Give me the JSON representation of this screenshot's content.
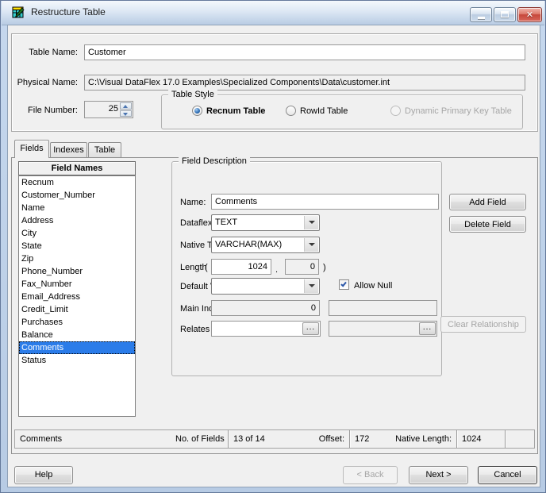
{
  "window": {
    "title": "Restructure Table",
    "icon": "table-edit",
    "controls": {
      "minimize": "minimize",
      "maximize": "maximize",
      "close_glyph": "✕"
    }
  },
  "colors": {
    "titlebar": "#D5E2F2",
    "frame": "#BDD1E9",
    "dialog_bg": "#F0F0F0",
    "selection": "#2B7CE9",
    "close_button": "#C6473B"
  },
  "form": {
    "table_name": {
      "label": "Table Name:",
      "value": "Customer"
    },
    "physical_name": {
      "label": "Physical Name:",
      "value": "C:\\Visual DataFlex 17.0 Examples\\Specialized Components\\Data\\customer.int"
    },
    "file_number": {
      "label": "File Number:",
      "value": "25"
    },
    "table_style": {
      "legend": "Table Style",
      "options": [
        {
          "label": "Recnum Table",
          "selected": true,
          "disabled": false
        },
        {
          "label": "RowId Table",
          "selected": false,
          "disabled": false
        },
        {
          "label": "Dynamic Primary Key Table",
          "selected": false,
          "disabled": true
        }
      ]
    }
  },
  "tabs": [
    {
      "label": "Fields",
      "active": true
    },
    {
      "label": "Indexes",
      "active": false
    },
    {
      "label": "Table",
      "active": false
    }
  ],
  "field_list": {
    "header": "Field Names",
    "selected": "Comments",
    "items": [
      "Recnum",
      "Customer_Number",
      "Name",
      "Address",
      "City",
      "State",
      "Zip",
      "Phone_Number",
      "Fax_Number",
      "Email_Address",
      "Credit_Limit",
      "Purchases",
      "Balance",
      "Comments",
      "Status"
    ]
  },
  "field_description": {
    "legend": "Field Description",
    "name": {
      "label": "Name:",
      "value": "Comments"
    },
    "dataflex_type": {
      "label": "Dataflex Type:",
      "value": "TEXT"
    },
    "native_type": {
      "label": "Native Type:",
      "value": "VARCHAR(MAX)"
    },
    "length": {
      "label": "Length",
      "paren_open": "(",
      "value": "1024",
      "separator": ".",
      "decimals": "0",
      "paren_close": ")"
    },
    "default_value": {
      "label": "Default Value",
      "value": ""
    },
    "allow_null": {
      "label": "Allow Null",
      "checked": true
    },
    "main_index": {
      "label": "Main Index",
      "value": "0",
      "value2": ""
    },
    "relates_to": {
      "label": "Relates To",
      "value": "",
      "value2": ""
    }
  },
  "icons": {
    "ellipsis": "..."
  },
  "side_buttons": {
    "add": "Add Field",
    "delete": "Delete Field",
    "clear": "Clear Relationship"
  },
  "status_bar": {
    "field": "Comments",
    "no_of_fields_label": "No. of Fields",
    "no_of_fields": "13 of 14",
    "offset_label": "Offset:",
    "offset": "172",
    "native_length_label": "Native Length:",
    "native_length": "1024"
  },
  "footer": {
    "help": "Help",
    "back": "< Back",
    "next": "Next >",
    "cancel": "Cancel"
  }
}
